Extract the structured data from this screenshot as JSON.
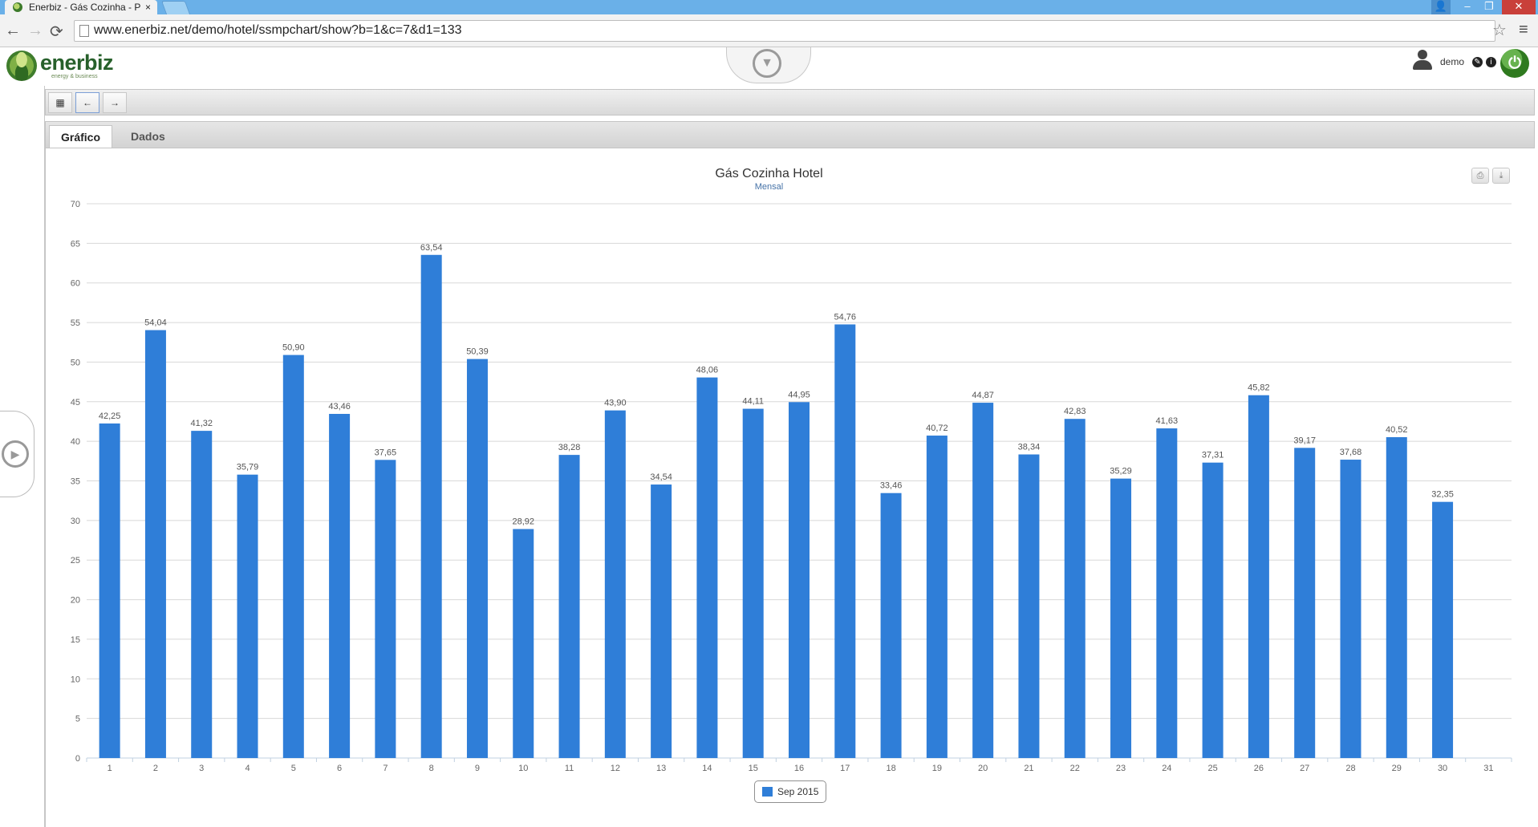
{
  "browser": {
    "tab_title": "Enerbiz - Gás Cozinha - P",
    "tab_close": "×",
    "url": "www.enerbiz.net/demo/hotel/ssmpchart/show?b=1&c=7&d1=133",
    "window_controls": {
      "minimize": "–",
      "restore": "❐",
      "close": "✕"
    },
    "nav": {
      "back": "←",
      "forward": "→",
      "reload": "⟳"
    },
    "star": "☆",
    "menu": "≡"
  },
  "header": {
    "logo_text": "enerbiz",
    "logo_tagline": "energy & business",
    "center_icon": "▼",
    "username": "demo",
    "settings_glyph": "✎",
    "info_glyph": "i",
    "power_glyph": "⏻"
  },
  "toolbar": {
    "calendar": "▦",
    "prev": "←",
    "next": "→"
  },
  "tabs": [
    {
      "label": "Gráfico",
      "active": true
    },
    {
      "label": "Dados",
      "active": false
    }
  ],
  "sidebar": {
    "toggle_icon": "▶"
  },
  "export": {
    "print": "⎙",
    "download": "⤓"
  },
  "colors": {
    "bar": "#2f7ed8",
    "grid": "#d8d8d8",
    "label": "#666666"
  },
  "icons": [
    "page-icon",
    "star-icon",
    "menu-icon",
    "logo-icon",
    "chevron-down-icon",
    "user-icon",
    "pencil-icon",
    "info-icon",
    "power-icon",
    "calendar-icon",
    "arrow-left-icon",
    "arrow-right-icon",
    "play-icon",
    "print-icon",
    "download-icon"
  ],
  "chart_data": {
    "type": "bar",
    "title": "Gás Cozinha Hotel",
    "subtitle": "Mensal",
    "categories": [
      "1",
      "2",
      "3",
      "4",
      "5",
      "6",
      "7",
      "8",
      "9",
      "10",
      "11",
      "12",
      "13",
      "14",
      "15",
      "16",
      "17",
      "18",
      "19",
      "20",
      "21",
      "22",
      "23",
      "24",
      "25",
      "26",
      "27",
      "28",
      "29",
      "30",
      "31"
    ],
    "series": [
      {
        "name": "Sep 2015",
        "values": [
          42.25,
          54.04,
          41.32,
          35.79,
          50.9,
          43.46,
          37.65,
          63.54,
          50.39,
          28.92,
          38.28,
          43.9,
          34.54,
          48.06,
          44.11,
          44.95,
          54.76,
          33.46,
          40.72,
          44.87,
          38.34,
          42.83,
          35.29,
          41.63,
          37.31,
          45.82,
          39.17,
          37.68,
          40.52,
          32.35,
          null
        ],
        "labels": [
          "42,25",
          "54,04",
          "41,32",
          "35,79",
          "50,90",
          "43,46",
          "37,65",
          "63,54",
          "50,39",
          "28,92",
          "38,28",
          "43,90",
          "34,54",
          "48,06",
          "44,11",
          "44,95",
          "54,76",
          "33,46",
          "40,72",
          "44,87",
          "38,34",
          "42,83",
          "35,29",
          "41,63",
          "37,31",
          "45,82",
          "39,17",
          "37,68",
          "40,52",
          "32,35",
          ""
        ]
      }
    ],
    "ylim": [
      0,
      70
    ],
    "yticks": [
      "0",
      "5",
      "10",
      "15",
      "20",
      "25",
      "30",
      "35",
      "40",
      "45",
      "50",
      "55",
      "60",
      "65",
      "70"
    ],
    "xlabel": "",
    "ylabel": "",
    "grid": true,
    "legend": "bottom-center"
  }
}
